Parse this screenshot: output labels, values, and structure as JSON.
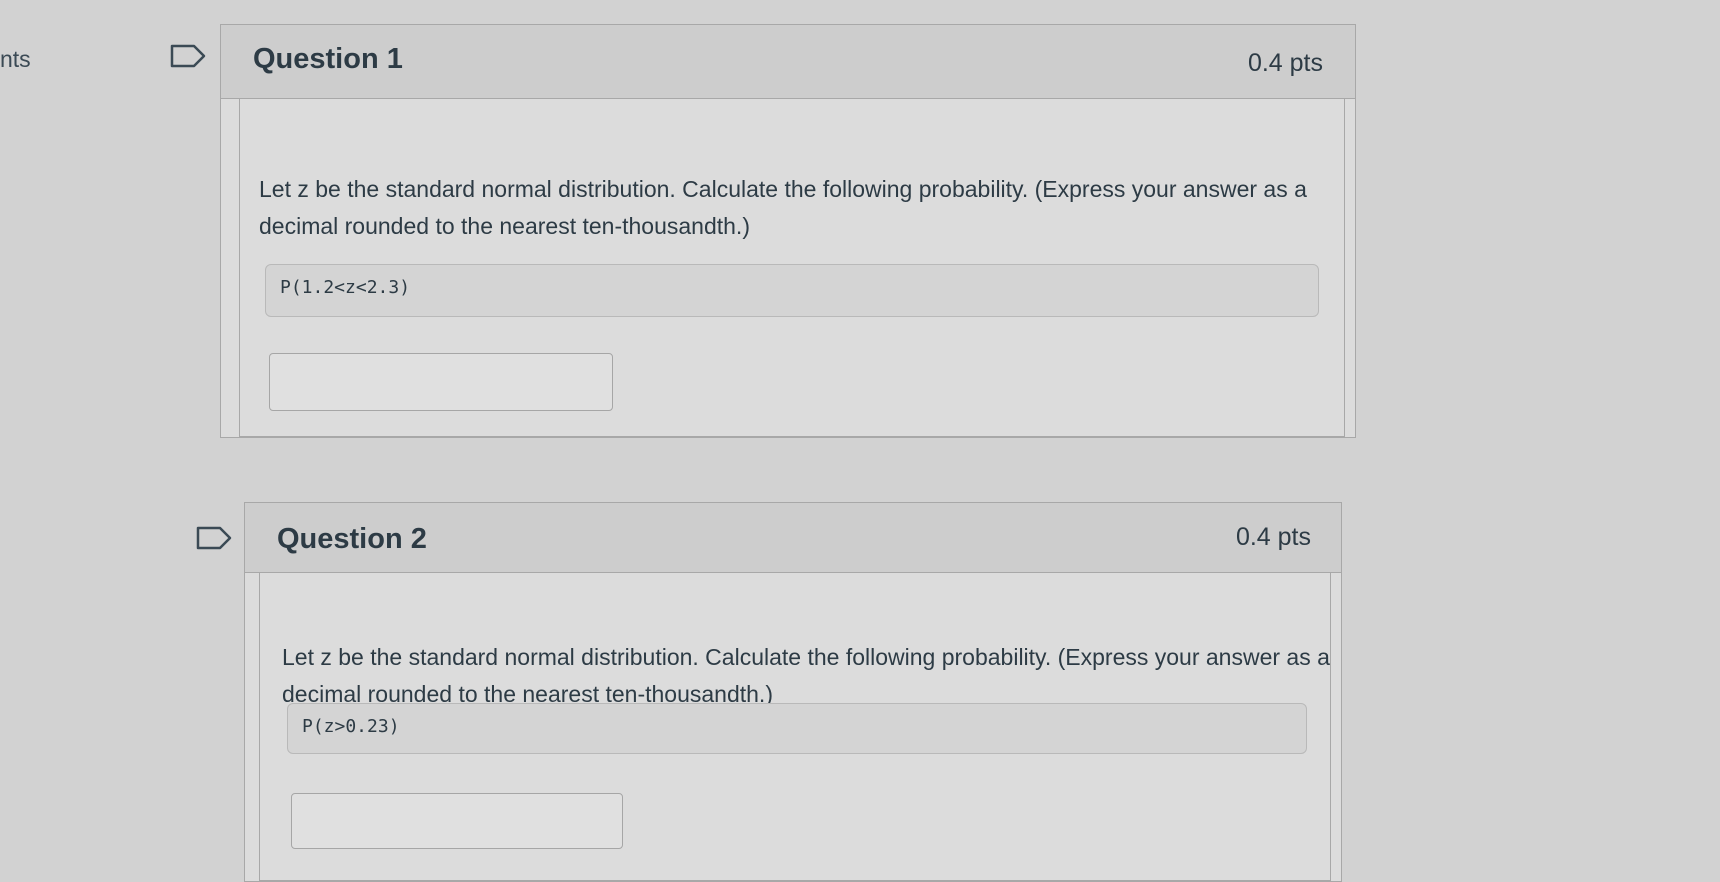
{
  "sidebar": {
    "fragment_text": "nts"
  },
  "questions": [
    {
      "title": "Question 1",
      "points": "0.4 pts",
      "prompt": "Let z be the standard normal distribution. Calculate the following probability. (Express your answer as a decimal rounded to the nearest ten-thousandth.)",
      "formula": "P(1.2<z<2.3)",
      "answer_value": ""
    },
    {
      "title": "Question 2",
      "points": "0.4 pts",
      "prompt": "Let z be the standard normal distribution. Calculate the following probability. (Express your answer as a decimal rounded to the nearest ten-thousandth.)",
      "formula": "P(z>0.23)",
      "answer_value": ""
    }
  ],
  "icons": {
    "flag": "bookmark-flag-icon"
  },
  "colors": {
    "background": "#d2d2d2",
    "text": "#2d3b45",
    "header_bg": "#cdcdcd",
    "border": "#a8a8a8"
  }
}
